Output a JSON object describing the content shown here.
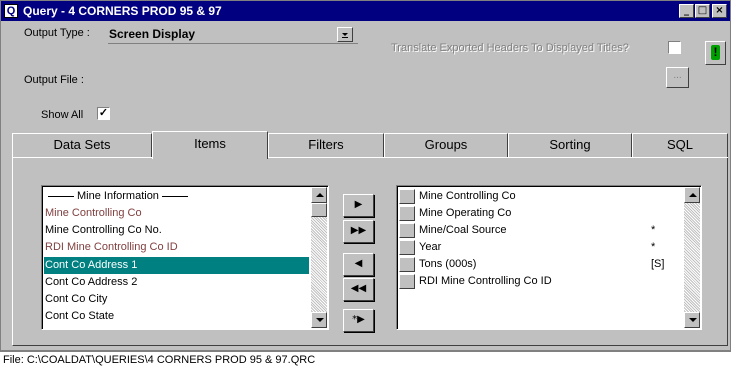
{
  "window": {
    "icon_letter": "Q",
    "title": "Query - 4 CORNERS PROD 95 & 97",
    "controls": {
      "minimize": "_",
      "maximize": "□",
      "close": "×"
    }
  },
  "options": {
    "output_type_label": "Output Type :",
    "output_type_value": "Screen Display",
    "translate_label": "Translate Exported Headers To Displayed Titles?",
    "translate_checked": false,
    "execute_label": "!",
    "output_file_label": "Output File :",
    "browse_label": "...",
    "show_all_label": "Show All",
    "show_all_checked": true,
    "show_all_mark": "✓"
  },
  "tabs": [
    "Data Sets",
    "Items",
    "Filters",
    "Groups",
    "Sorting",
    "SQL"
  ],
  "active_tab": "Items",
  "left_list": {
    "header": "Mine Information",
    "items": [
      {
        "label": "Mine Controlling Co",
        "style": "brown"
      },
      {
        "label": "Mine Controlling Co No.",
        "style": "normal"
      },
      {
        "label": "RDI Mine Controlling Co ID",
        "style": "brown"
      },
      {
        "label": "Cont Co Address 1",
        "style": "selected"
      },
      {
        "label": "Cont Co Address 2",
        "style": "normal"
      },
      {
        "label": "Cont Co City",
        "style": "normal"
      },
      {
        "label": "Cont Co State",
        "style": "normal"
      }
    ]
  },
  "move_buttons": {
    "add": "▶",
    "add_all": "▶▶",
    "remove": "◀",
    "remove_all": "◀◀",
    "add_special": "*▶"
  },
  "right_list": {
    "items": [
      {
        "label": "Mine Controlling Co",
        "flag": ""
      },
      {
        "label": "Mine Operating Co",
        "flag": ""
      },
      {
        "label": "Mine/Coal Source",
        "flag": "*"
      },
      {
        "label": "Year",
        "flag": "*"
      },
      {
        "label": "Tons (000s)",
        "flag": "[S]"
      },
      {
        "label": "RDI Mine Controlling Co ID",
        "flag": ""
      }
    ]
  },
  "status": {
    "text": "File: C:\\COALDAT\\QUERIES\\4 CORNERS PROD 95 & 97.QRC"
  },
  "colors": {
    "titlebar": "#000080",
    "selection": "#008080",
    "brown_text": "#804040",
    "execute_green": "#00a000"
  }
}
